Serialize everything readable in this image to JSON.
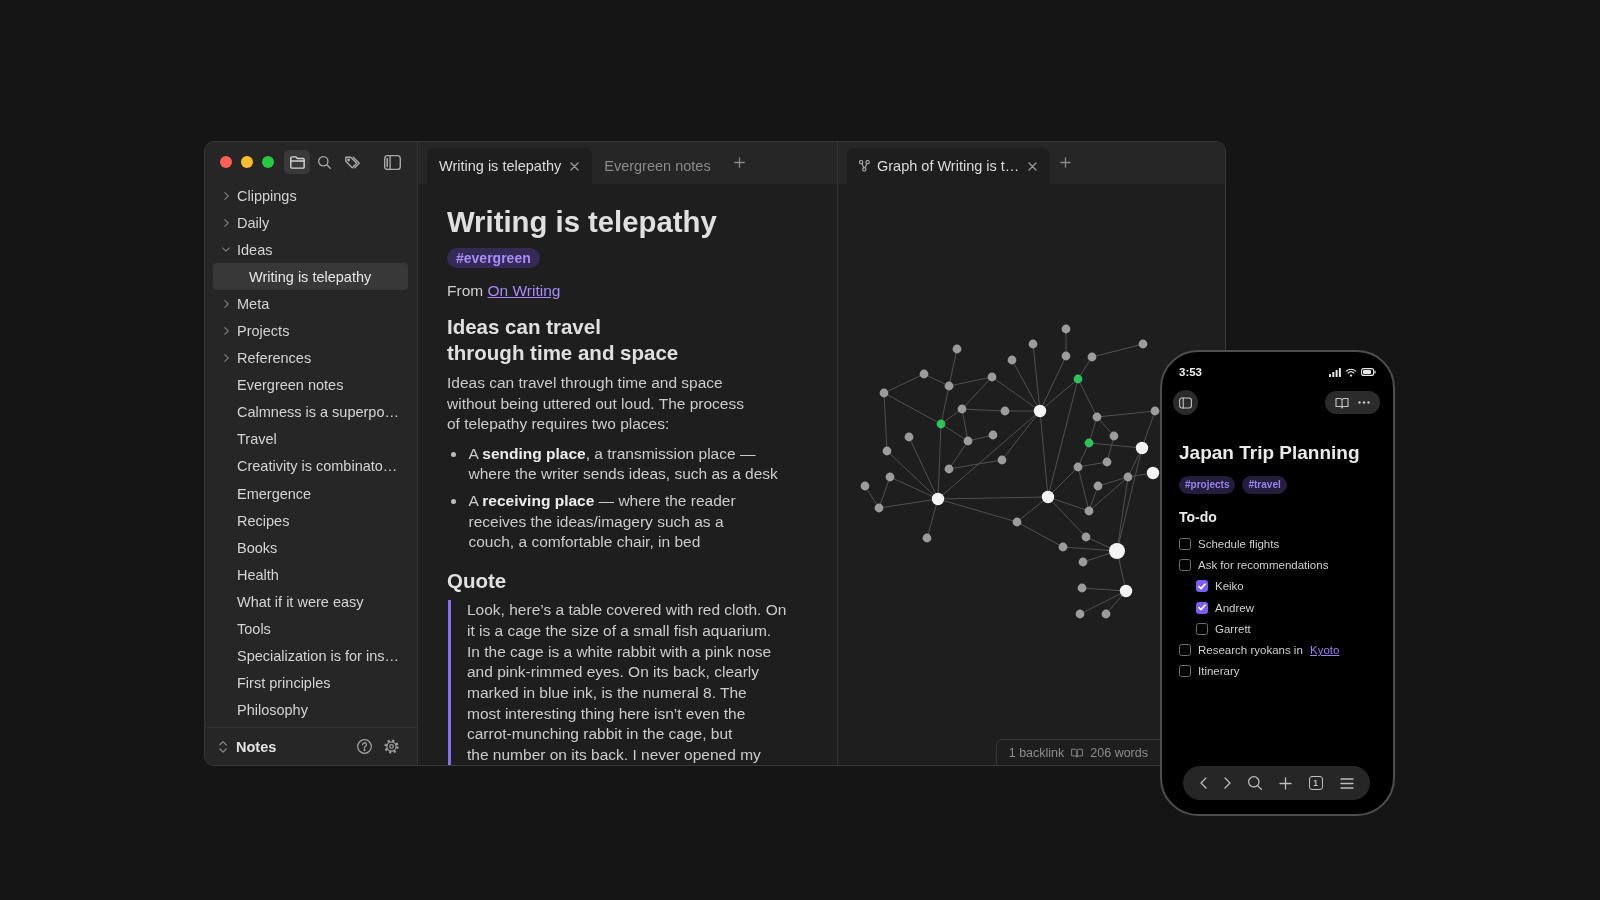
{
  "window": {
    "sidebar": {
      "toolbar": [
        {
          "selected": true
        },
        {
          "selected": false
        },
        {
          "selected": false
        }
      ],
      "tree": [
        {
          "kind": "folder",
          "label": "Clippings",
          "expanded": false,
          "selected": false
        },
        {
          "kind": "folder",
          "label": "Daily",
          "expanded": false,
          "selected": false
        },
        {
          "kind": "folder",
          "label": "Ideas",
          "expanded": true,
          "selected": false,
          "children": [
            {
              "kind": "file",
              "label": "Writing is telepathy",
              "selected": true
            }
          ]
        },
        {
          "kind": "folder",
          "label": "Meta",
          "expanded": false,
          "selected": false
        },
        {
          "kind": "folder",
          "label": "Projects",
          "expanded": false,
          "selected": false
        },
        {
          "kind": "folder",
          "label": "References",
          "expanded": false,
          "selected": false
        },
        {
          "kind": "file",
          "label": "Evergreen notes",
          "selected": false
        },
        {
          "kind": "file",
          "label": "Calmness is a superpo…",
          "selected": false
        },
        {
          "kind": "file",
          "label": "Travel",
          "selected": false
        },
        {
          "kind": "file",
          "label": "Creativity is combinato…",
          "selected": false
        },
        {
          "kind": "file",
          "label": "Emergence",
          "selected": false
        },
        {
          "kind": "file",
          "label": "Recipes",
          "selected": false
        },
        {
          "kind": "file",
          "label": "Books",
          "selected": false
        },
        {
          "kind": "file",
          "label": "Health",
          "selected": false
        },
        {
          "kind": "file",
          "label": "What if it were easy",
          "selected": false
        },
        {
          "kind": "file",
          "label": "Tools",
          "selected": false
        },
        {
          "kind": "file",
          "label": "Specialization is for ins…",
          "selected": false
        },
        {
          "kind": "file",
          "label": "First principles",
          "selected": false
        },
        {
          "kind": "file",
          "label": "Philosophy",
          "selected": false
        }
      ],
      "vault": "Notes"
    },
    "panes": [
      {
        "kind": "editor",
        "tabs": [
          {
            "label": "Writing is telepathy",
            "selected": true
          },
          {
            "label": "Evergreen notes",
            "selected": false
          }
        ],
        "note": {
          "title": "Writing is telepathy",
          "tags": [
            "#evergreen"
          ],
          "source": {
            "prefix": "From",
            "link": "On Writing"
          },
          "blocks": [
            {
              "kind": "heading",
              "text": "Ideas can travel\nthrough time and space"
            },
            {
              "kind": "paragraph",
              "text": "Ideas can travel through time and space\nwithout being uttered out loud. The process\nof telepathy requires two places:"
            },
            {
              "kind": "bullets",
              "items": [
                "A **sending place**, a transmission place —\nwhere the writer sends ideas, such as a desk",
                "A **receiving place** — where the reader\nreceives the ideas/imagery such as a\ncouch, a comfortable chair, in bed"
              ]
            },
            {
              "kind": "heading",
              "text": "Quote"
            },
            {
              "kind": "quote",
              "text": "Look, here’s a table covered with red cloth. On\nit is a cage the size of a small fish aquarium.\nIn the cage is a white rabbit with a pink nose\nand pink-rimmed eyes. On its back, clearly\nmarked in blue ink, is the numeral 8. The\nmost interesting thing here isn’t even the\ncarrot-munching rabbit in the cage, but\nthe number on its back. I never opened my"
            }
          ]
        }
      },
      {
        "kind": "graph",
        "tabs": [
          {
            "label": "Graph of Writing is t…",
            "selected": true
          }
        ]
      }
    ],
    "status_bar": {
      "backlinks": "1 backlink",
      "words": "206 words"
    }
  },
  "phone": {
    "status_bar": {
      "time": "3:53"
    },
    "note": {
      "title": "Japan Trip Planning",
      "tags": [
        "#projects",
        "#travel"
      ],
      "heading": "To-do",
      "tasks": [
        {
          "text": "Schedule flights",
          "checked": false
        },
        {
          "text": "Ask for recommendations",
          "checked": false,
          "children": [
            {
              "text": "Keiko",
              "checked": true
            },
            {
              "text": "Andrew",
              "checked": true
            },
            {
              "text": "Garrett",
              "checked": false
            }
          ]
        },
        {
          "text": "Research ryokans in",
          "link": "Kyoto",
          "checked": false
        },
        {
          "text": "Itinerary",
          "checked": false
        }
      ]
    },
    "toolbar": {
      "tab_count": "1"
    }
  }
}
